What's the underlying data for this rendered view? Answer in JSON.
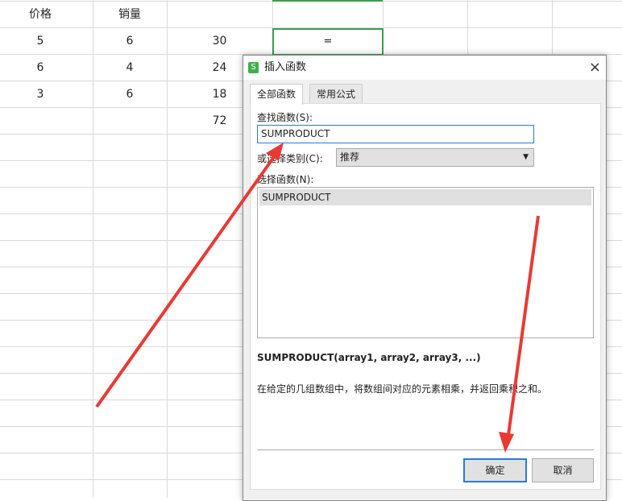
{
  "sheet": {
    "headers": [
      "价格",
      "销量"
    ],
    "rows": [
      [
        "5",
        "6",
        "30"
      ],
      [
        "6",
        "4",
        "24"
      ],
      [
        "3",
        "6",
        "18"
      ]
    ],
    "total": "72",
    "active_cell": "="
  },
  "dialog": {
    "title": "插入函数",
    "close": "×",
    "tabs": [
      "全部函数",
      "常用公式"
    ],
    "search_label": "查找函数(S):",
    "search_value": "SUMPRODUCT",
    "category_label": "或选择类别(C):",
    "category_value": "推荐",
    "list_label": "选择函数(N):",
    "functions": [
      "SUMPRODUCT"
    ],
    "signature": "SUMPRODUCT(array1, array2, array3, ...)",
    "description": "在给定的几组数组中，将数组间对应的元素相乘，并返回乘积之和。",
    "ok": "确定",
    "cancel": "取消"
  },
  "annotation_color": "#e83a34"
}
